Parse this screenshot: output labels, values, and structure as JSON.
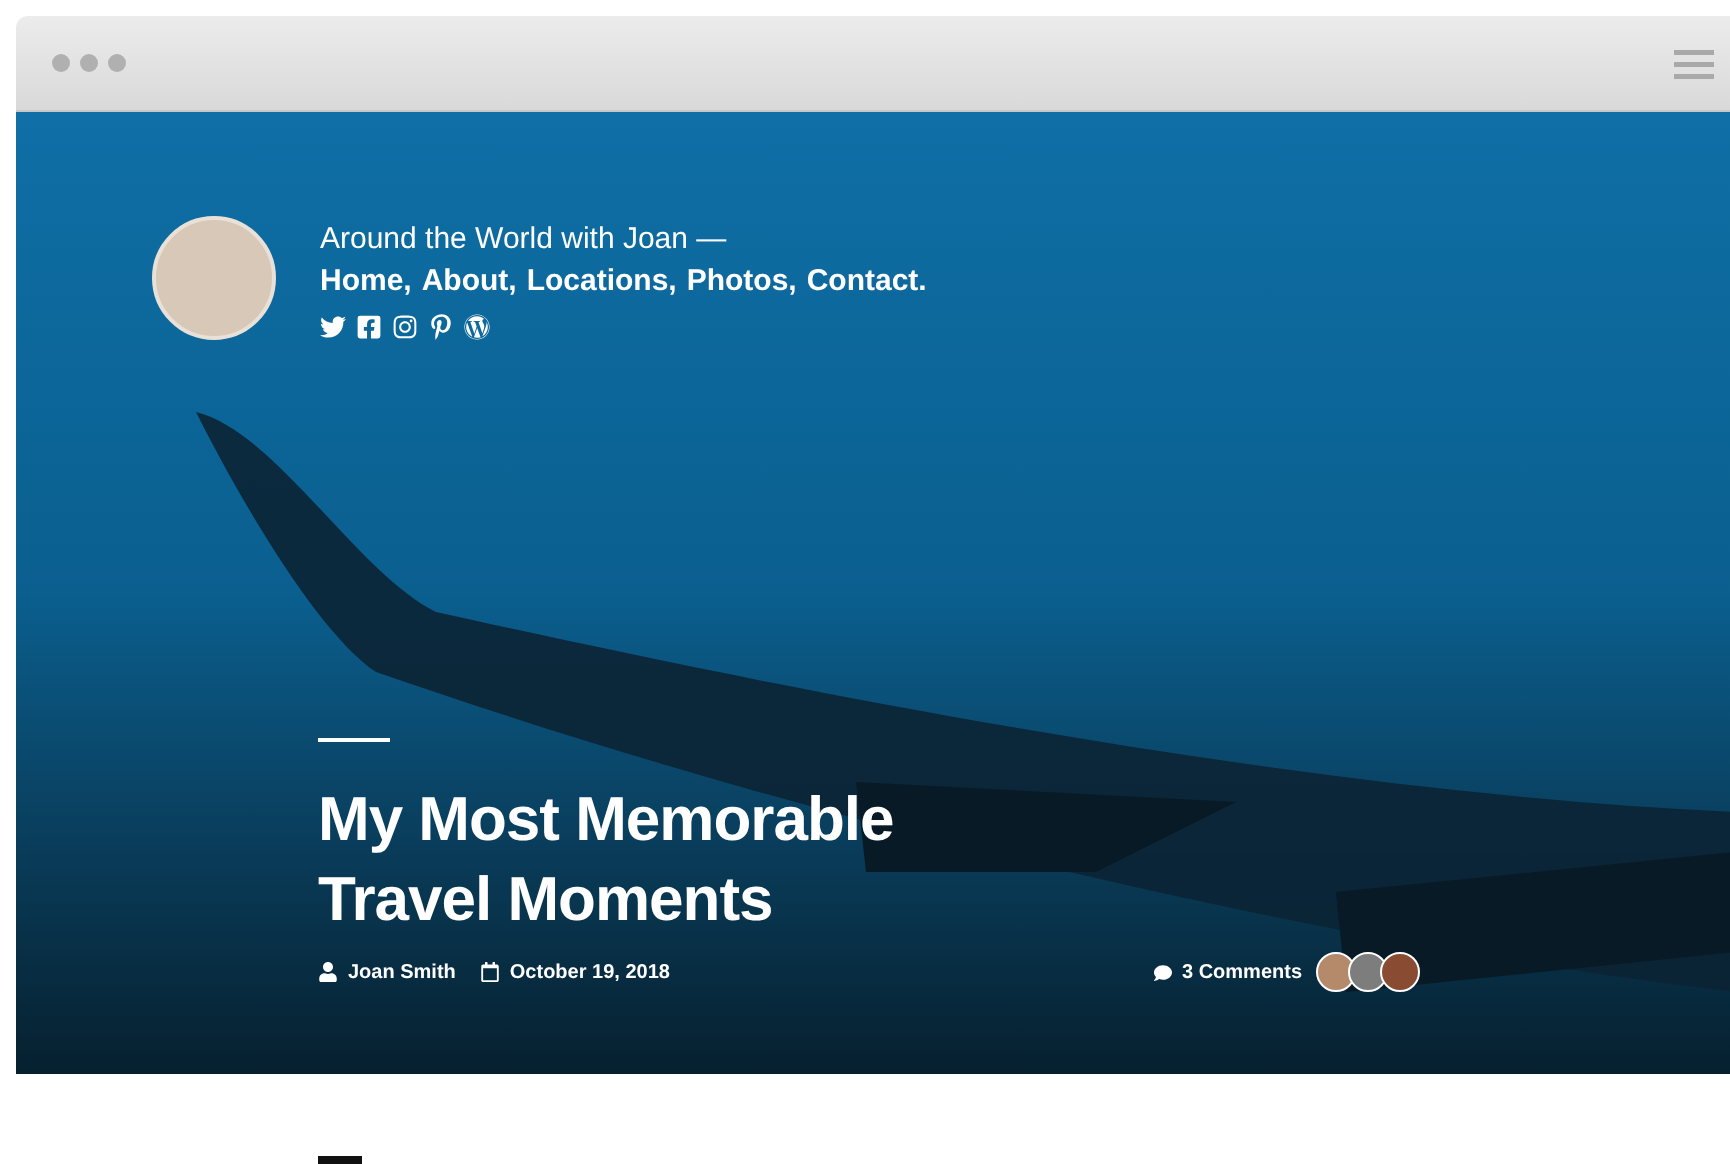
{
  "site": {
    "tagline": "Around the World with Joan —",
    "menu": [
      {
        "label": "Home,"
      },
      {
        "label": "About,"
      },
      {
        "label": "Locations,"
      },
      {
        "label": "Photos,"
      },
      {
        "label": "Contact."
      }
    ],
    "social": [
      {
        "kind": "twitter"
      },
      {
        "kind": "facebook"
      },
      {
        "kind": "instagram"
      },
      {
        "kind": "pinterest"
      },
      {
        "kind": "wordpress"
      }
    ]
  },
  "post": {
    "title_lines": [
      "My Most Memorable",
      "Travel Moments"
    ],
    "author": "Joan Smith",
    "date": "October 19, 2018",
    "comments": "3 Comments",
    "commenters": [
      {
        "color": "#b58a6a"
      },
      {
        "color": "#7d7d7d"
      },
      {
        "color": "#8a4b33"
      }
    ]
  }
}
